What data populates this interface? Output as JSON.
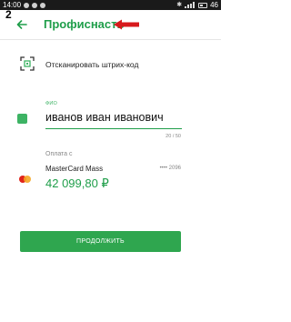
{
  "status_bar": {
    "time": "14:00",
    "battery": "46"
  },
  "overlay_number": "2",
  "header": {
    "title": "Профиснасть"
  },
  "scan": {
    "label": "Отсканировать штрих-код"
  },
  "fio": {
    "label": "ФИО",
    "value": "иванов иван иванович",
    "counter": "20 / 50"
  },
  "payment": {
    "label": "Оплата с",
    "card_name": "MasterCard Mass",
    "card_mask": "•••• 2096",
    "balance": "42 099,80 ₽"
  },
  "submit_button": {
    "label": "ПРОДОЛЖИТЬ"
  },
  "colors": {
    "accent": "#1f9e4a",
    "button": "#2fa64f",
    "annotation_arrow": "#d7191c"
  }
}
